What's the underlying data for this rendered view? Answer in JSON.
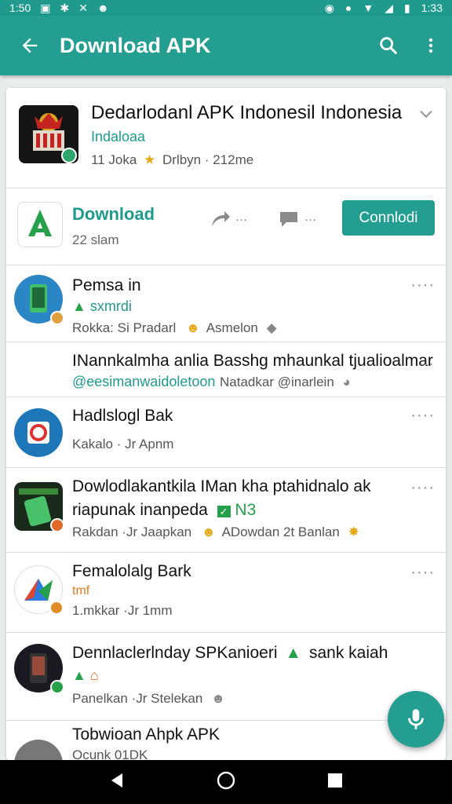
{
  "status_bar": {
    "time": "1:50",
    "battery": "1:33"
  },
  "app_bar": {
    "title": "Download APK",
    "back_icon": "arrow-left-icon",
    "search_icon": "search-icon",
    "menu_icon": "more-vertical-icon"
  },
  "hero": {
    "title": "Dedarlodanl APK Indonesil Indonesia",
    "subtitle": "Indaloaa",
    "meta_left": "11 Joka",
    "meta_right": "Drlbyn · 212me",
    "accent": "#1f9a8c"
  },
  "download_row": {
    "label": "Download",
    "size": "22 slam",
    "share_count": "···",
    "comment_count": "···",
    "button_label": "Connlodi"
  },
  "items": [
    {
      "title": "Pemsa in",
      "tag": "sxmrdi",
      "meta_a": "Rokka: Si Pradarl",
      "meta_b": "Asmelon"
    },
    {
      "title": "INannkalmha anlia Basshg mhaunkal tjualioalmar",
      "tag": "@eesimanwaidoletoon",
      "meta_b": "Natadkar @inarlein"
    },
    {
      "title": "Hadlslogl Bak",
      "meta_a": "Kakalo · Jr Apnm"
    },
    {
      "title": "Dowlodlakantkila IMan kha ptahidnalo ak",
      "subtitle": "riapunak inanpeda",
      "tag": "N3",
      "meta_a": "Rakdan ·Jr Jaapkan",
      "meta_b": "ADowdan 2t Banlan"
    },
    {
      "title": "Femalolalg Bark",
      "tag": "tmf",
      "meta_a": "1.mkkar ·Jr 1mm"
    },
    {
      "title": "Dennlaclerlnday SPKanioeri",
      "tag_inline": "sank kaiah",
      "meta_a": "Panelkan ·Jr Stelekan"
    },
    {
      "title": "Tobwioan Ahpk APK",
      "meta_a": "Ocunk 01DK"
    }
  ],
  "colors": {
    "primary": "#239e90",
    "text": "#111111",
    "muted": "#555555"
  }
}
